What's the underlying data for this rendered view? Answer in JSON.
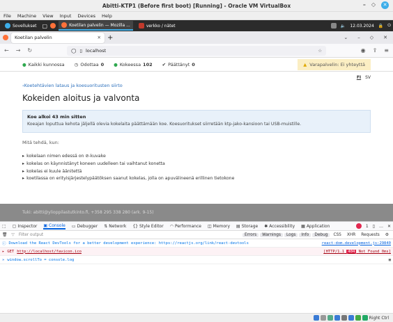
{
  "vbox": {
    "title": "Abitti-KTP1 (Before first boot) [Running] - Oracle VM VirtualBox",
    "menu": [
      "File",
      "Machine",
      "View",
      "Input",
      "Devices",
      "Help"
    ],
    "bottom_label": "Right Ctrl"
  },
  "taskbar": {
    "apps_label": "Sovellukset",
    "items": [
      {
        "label": "Koetilan palvelin — Mozilla ..."
      },
      {
        "label": "verkko / nätet"
      }
    ],
    "date": "12.03.2024"
  },
  "browser": {
    "tab_title": "Koetilan palvelin",
    "url": "localhost"
  },
  "status": {
    "ok": "Kaikki kunnossa",
    "waiting_label": "Odottaa",
    "waiting": "0",
    "in_exam_label": "Kokeessa",
    "in_exam": "102",
    "finished_label": "Päättänyt",
    "finished": "0",
    "warning": "Varapalvelin: Ei yhteyttä"
  },
  "page": {
    "lang_fi": "FI",
    "lang_sv": "SV",
    "back_link": "Koetehtävien lataus ja koesuoritusten siirto",
    "heading": "Kokeiden aloitus ja valvonta",
    "info_title": "Koe alkoi 43 min sitten",
    "info_text": "Koeajan loputtua kehota jäljellä olevia kokelaita päättämään koe. Koesuoritukset siirretään ktp-jako-kansioon tai USB-muistille.",
    "todo_intro": "Mitä tehdä, kun:",
    "todo_items": [
      "kokelaan nimen edessä on ⊘-kuvake",
      "kokelas on käynnistänyt koneen uudelleen tai vaihtanut konetta",
      "kokelas ei kuule äänitettä",
      "koetilassa on erityisjärjestelypäätöksen saanut kokelas, jolla on apuvälineenä erillinen tietokone"
    ],
    "footer": "Tuki: abitti@ylioppilastutkinto.fi, +358 295 338 280 (ark. 9-15)"
  },
  "devtools": {
    "tabs": [
      "Inspector",
      "Console",
      "Debugger",
      "Network",
      "Style Editor",
      "Performance",
      "Memory",
      "Storage",
      "Accessibility",
      "Application"
    ],
    "error_count": "1",
    "filter_placeholder": "Filter output",
    "filter_buttons": [
      "Errors",
      "Warnings",
      "Logs",
      "Info",
      "Debug",
      "CSS",
      "XHR",
      "Requests"
    ],
    "logs": [
      {
        "text": "Download the React DevTools for a better development experience: https://reactjs.org/link/react-devtools",
        "source": "react-dom.development.js:29840"
      },
      {
        "method": "GET",
        "url": "http://localhost/favicon.ico",
        "protocol": "[HTTP/1.1",
        "status": "404",
        "status_text": "Not Found 0ms]"
      },
      {
        "text": "window.scrollTo = console.log"
      }
    ]
  },
  "colors": {
    "accent": "#0060df",
    "ok": "#2fa84f",
    "warn": "#fbeec3"
  }
}
